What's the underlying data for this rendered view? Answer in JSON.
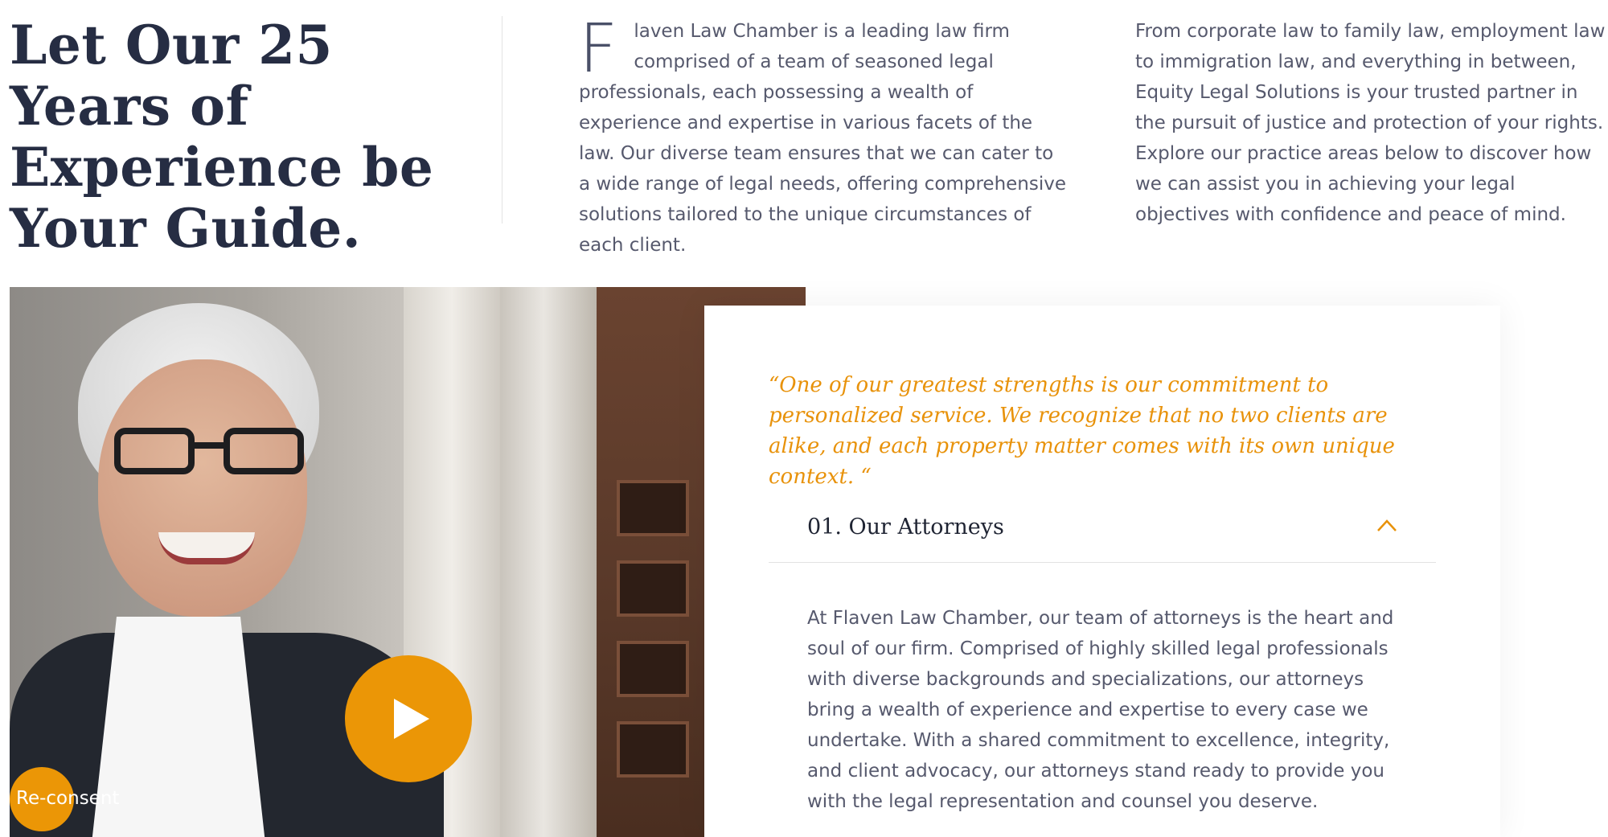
{
  "hero": {
    "headline": "Let Our 25 Years of Experience be Your Guide.",
    "intro_dropcap": "F",
    "intro_col1": "laven Law Chamber is a leading law firm comprised of a team of seasoned legal professionals, each possessing a wealth of experience and expertise in various facets of the law. Our diverse team ensures that we can cater to a wide range of legal needs, offering comprehensive solutions tailored to the unique circumstances of each client.",
    "intro_col2": "From corporate law to family law, employment law to immigration law, and everything in between, Equity Legal Solutions is your trusted partner in the pursuit of justice and protection of your rights. Explore our practice areas below to discover how we can assist you in achieving your legal objectives with confidence and peace of mind."
  },
  "media": {
    "play_icon": "play-icon",
    "reconsent_label": "Re-consent"
  },
  "card": {
    "quote": "“One of our greatest strengths is our commitment to personalized service. We recognize that no two clients are alike, and each property matter comes with its own unique context. “",
    "accordion": {
      "title": "01. Our Attorneys",
      "chevron_icon": "chevron-up-icon",
      "body": "At Flaven Law Chamber, our team of attorneys is the heart and soul of our firm. Comprised of highly skilled legal professionals with diverse backgrounds and specializations, our attorneys bring a wealth of experience and expertise to every case we undertake. With a shared commitment to excellence, integrity, and client advocacy, our attorneys stand ready to provide you with the legal representation and counsel you deserve."
    }
  },
  "colors": {
    "accent": "#eb9606",
    "heading": "#262d43",
    "body_text": "#56596d"
  }
}
